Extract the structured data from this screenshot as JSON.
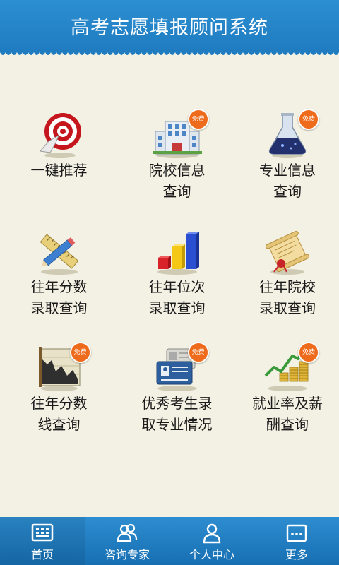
{
  "header": {
    "title": "高考志愿填报顾问系统"
  },
  "badge_text": "免费",
  "grid": [
    {
      "line1": "一键推荐",
      "line2": "",
      "icon": "target-icon",
      "free": false
    },
    {
      "line1": "院校信息",
      "line2": "查询",
      "icon": "school-building-icon",
      "free": true
    },
    {
      "line1": "专业信息",
      "line2": "查询",
      "icon": "flask-icon",
      "free": true
    },
    {
      "line1": "往年分数",
      "line2": "录取查询",
      "icon": "pencil-ruler-icon",
      "free": false
    },
    {
      "line1": "往年位次",
      "line2": "录取查询",
      "icon": "bar-chart-icon",
      "free": false
    },
    {
      "line1": "往年院校",
      "line2": "录取查询",
      "icon": "scroll-icon",
      "free": false
    },
    {
      "line1": "往年分数",
      "line2": "线查询",
      "icon": "line-chart-icon",
      "free": true
    },
    {
      "line1": "优秀考生录",
      "line2": "取专业情况",
      "icon": "id-cards-icon",
      "free": true
    },
    {
      "line1": "就业率及薪",
      "line2": "酬查询",
      "icon": "growth-coins-icon",
      "free": true
    }
  ],
  "tabs": [
    {
      "label": "首页",
      "icon": "home-grid-icon"
    },
    {
      "label": "咨询专家",
      "icon": "experts-icon"
    },
    {
      "label": "个人中心",
      "icon": "user-icon"
    },
    {
      "label": "更多",
      "icon": "more-icon"
    }
  ],
  "colors": {
    "header_blue": "#1f7cc0",
    "background": "#f3f1e3",
    "badge_orange": "#ef6b1c"
  }
}
